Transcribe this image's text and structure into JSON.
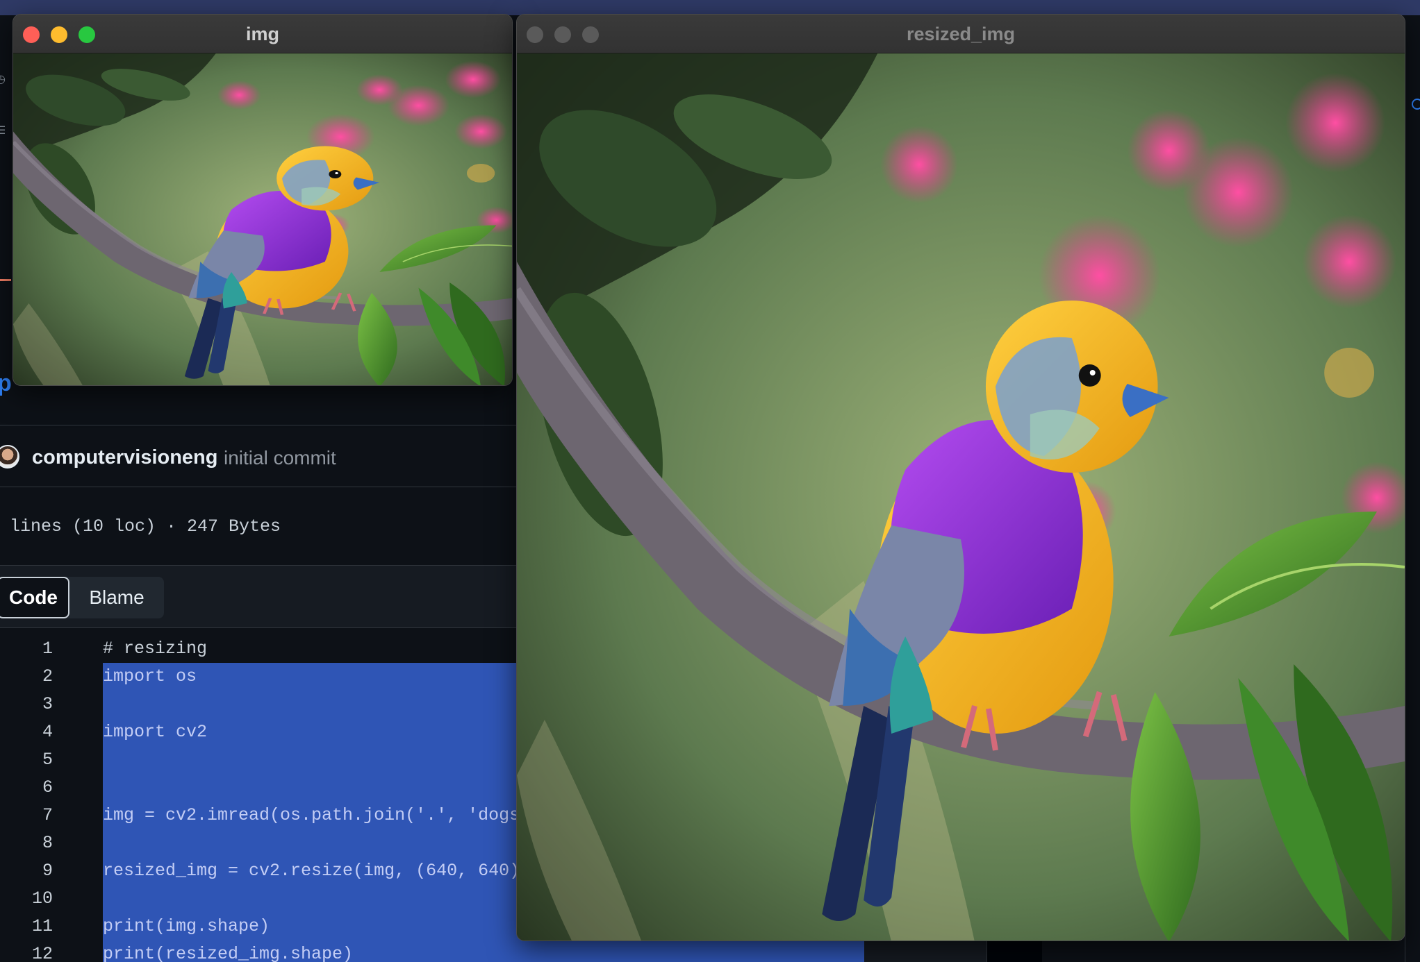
{
  "windows": {
    "original": {
      "title": "img"
    },
    "resized": {
      "title": "resized_img"
    }
  },
  "photo": {
    "subject": "bird-on-branch-image",
    "colors": {
      "background": "#5d7a4f",
      "bokeh_pink": "#e3348c",
      "bird_yellow": "#f2b51c",
      "bird_purple": "#8a2ed6",
      "branch": "#6d6670",
      "leaf": "#3f8a2a"
    }
  },
  "commit": {
    "author": "computervisioneng",
    "message": "initial commit"
  },
  "file_info": "lines (10 loc) · 247 Bytes",
  "tabs": {
    "code": "Code",
    "blame": "Blame"
  },
  "code_lines": [
    {
      "n": "1",
      "text": "# resizing"
    },
    {
      "n": "2",
      "text": "import os"
    },
    {
      "n": "3",
      "text": ""
    },
    {
      "n": "4",
      "text": "import cv2"
    },
    {
      "n": "5",
      "text": ""
    },
    {
      "n": "6",
      "text": ""
    },
    {
      "n": "7",
      "text": "img = cv2.imread(os.path.join('.', 'dogs"
    },
    {
      "n": "8",
      "text": ""
    },
    {
      "n": "9",
      "text": "resized_img = cv2.resize(img, (640, 640)"
    },
    {
      "n": "10",
      "text": ""
    },
    {
      "n": "11",
      "text": "print(img.shape)"
    },
    {
      "n": "12",
      "text": "print(resized_img.shape)"
    }
  ],
  "traffic_colors": {
    "close": "#fe5f57",
    "minimize": "#febc2e",
    "zoom": "#28c840",
    "inactive": "#5a5a5a"
  }
}
